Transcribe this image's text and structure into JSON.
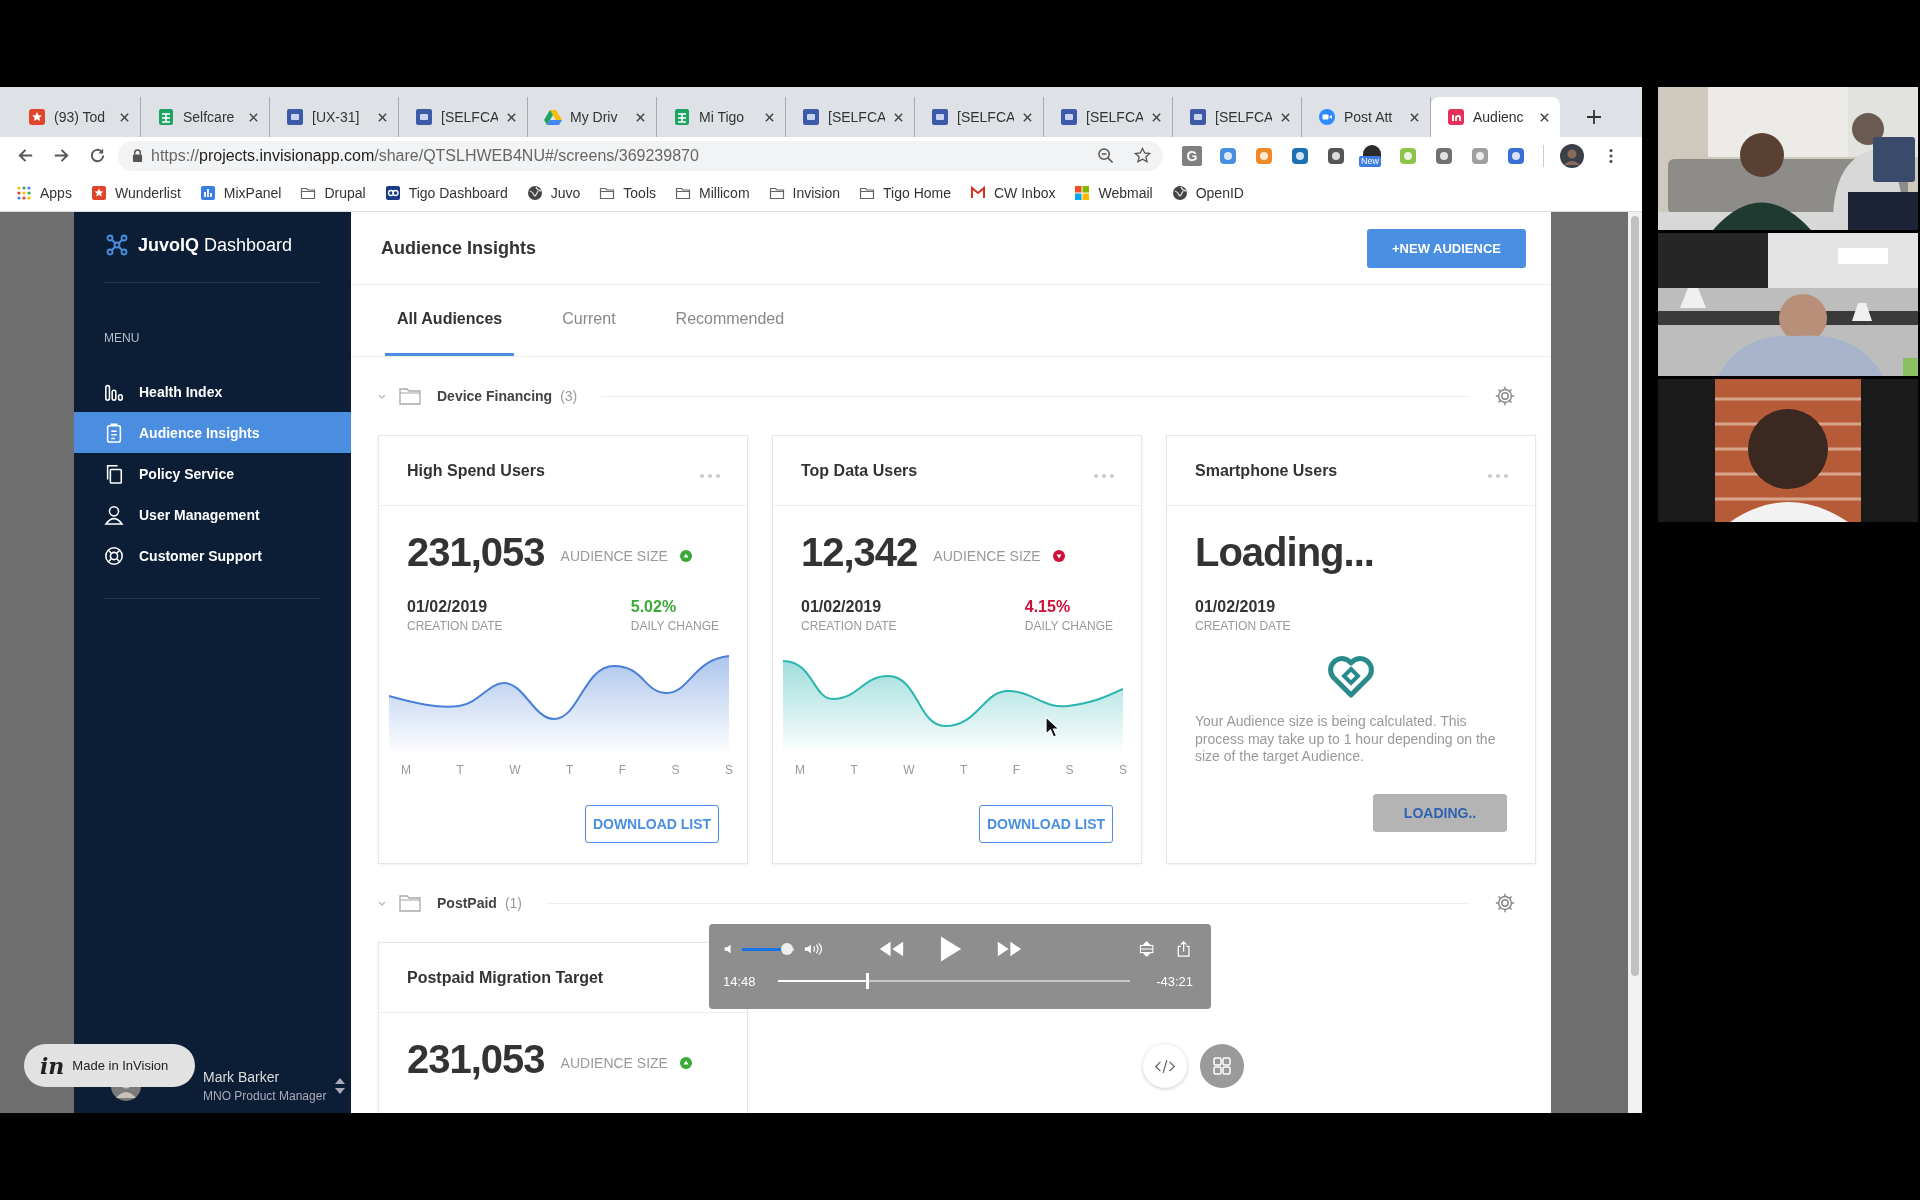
{
  "browser": {
    "tabs": [
      {
        "title": "(93) Tod",
        "kind": "star",
        "color": "#e0442c",
        "selected": false
      },
      {
        "title": "Selfcare",
        "kind": "sheet",
        "color": "#1fa463",
        "selected": false
      },
      {
        "title": "[UX-31]",
        "kind": "doc",
        "color": "#3d5aa8",
        "selected": false
      },
      {
        "title": "[SELFCA",
        "kind": "doc",
        "color": "#3d5aa8",
        "selected": false
      },
      {
        "title": "My Driv",
        "kind": "drive",
        "color": "#1fa463",
        "selected": false
      },
      {
        "title": "Mi Tigo",
        "kind": "sheet",
        "color": "#1fa463",
        "selected": false
      },
      {
        "title": "[SELFCA",
        "kind": "doc",
        "color": "#3d5aa8",
        "selected": false
      },
      {
        "title": "[SELFCA",
        "kind": "doc",
        "color": "#3d5aa8",
        "selected": false
      },
      {
        "title": "[SELFCA",
        "kind": "doc",
        "color": "#3d5aa8",
        "selected": false
      },
      {
        "title": "[SELFCA",
        "kind": "doc",
        "color": "#3d5aa8",
        "selected": false
      },
      {
        "title": "Post Att",
        "kind": "video",
        "color": "#2d8cff",
        "selected": false
      },
      {
        "title": "Audienc",
        "kind": "invision",
        "color": "#e6325a",
        "selected": true
      }
    ],
    "url": {
      "scheme": "https://",
      "host": "projects.invisionapp.com",
      "path": "/share/QTSLHWEB4NU#/screens/369239870"
    },
    "extensions": [
      {
        "kind": "letter",
        "label": "G",
        "color": "#808080"
      },
      {
        "kind": "plain",
        "color": "#4a8fe2"
      },
      {
        "kind": "plain",
        "color": "#f08a24"
      },
      {
        "kind": "plain",
        "color": "#1a6fb5"
      },
      {
        "kind": "plain",
        "color": "#555555"
      },
      {
        "kind": "badge",
        "badge": "New",
        "color": "#2a2a2a"
      },
      {
        "kind": "plain",
        "color": "#8bc34a"
      },
      {
        "kind": "plain",
        "color": "#707070"
      },
      {
        "kind": "plain",
        "color": "#a0a0a0"
      },
      {
        "kind": "plain",
        "color": "#3b6fd8"
      }
    ],
    "bookmarks": [
      {
        "label": "Apps",
        "kind": "apps"
      },
      {
        "label": "Wunderlist",
        "kind": "star"
      },
      {
        "label": "MixPanel",
        "kind": "chart"
      },
      {
        "label": "Drupal",
        "kind": "folder"
      },
      {
        "label": "Tigo Dashboard",
        "kind": "logo"
      },
      {
        "label": "Juvo",
        "kind": "globe"
      },
      {
        "label": "Tools",
        "kind": "folder"
      },
      {
        "label": "Millicom",
        "kind": "folder"
      },
      {
        "label": "Invision",
        "kind": "folder"
      },
      {
        "label": "Tigo Home",
        "kind": "folder"
      },
      {
        "label": "CW Inbox",
        "kind": "mail"
      },
      {
        "label": "Webmail",
        "kind": "windows"
      },
      {
        "label": "OpenID",
        "kind": "globe"
      }
    ]
  },
  "app": {
    "brand": "**JuvoIQ** Dashboard",
    "menu_label": "MENU",
    "menu": [
      {
        "label": "Health Index",
        "kind": "bars",
        "selected": false
      },
      {
        "label": "Audience Insights",
        "kind": "clipboard",
        "selected": true
      },
      {
        "label": "Policy Service",
        "kind": "copy",
        "selected": false
      },
      {
        "label": "User Management",
        "kind": "user",
        "selected": false
      },
      {
        "label": "Customer Support",
        "kind": "lifebuoy",
        "selected": false
      }
    ],
    "user": {
      "name": "Mark Barker",
      "role": "MNO Product Manager"
    },
    "page_title": "Audience Insights",
    "new_button": "+NEW AUDIENCE",
    "tabs": [
      {
        "label": "All Audiences",
        "selected": true
      },
      {
        "label": "Current",
        "selected": false
      },
      {
        "label": "Recommended",
        "selected": false
      }
    ],
    "groups": [
      {
        "name": "Device Financing",
        "count": "(3)",
        "cards": [
          {
            "kind": "stats",
            "title": "High Spend Users",
            "menu": true,
            "value": "231,053",
            "size_label": "AUDIENCE SIZE",
            "trend": {
              "kind": "up",
              "color": "#3aa935"
            },
            "date": "01/02/2019",
            "date_label": "CREATION DATE",
            "change": "5.02%",
            "change_label": "DAILY CHANGE",
            "color": "#4a7fd8",
            "days": [
              "M",
              "T",
              "W",
              "T",
              "F",
              "S",
              "S"
            ],
            "button": "DOWNLOAD LIST"
          },
          {
            "kind": "stats",
            "title": "Top Data Users",
            "menu": true,
            "value": "12,342",
            "size_label": "AUDIENCE SIZE",
            "trend": {
              "kind": "down",
              "color": "#d0103a"
            },
            "date": "01/02/2019",
            "date_label": "CREATION DATE",
            "change": "4.15%",
            "change_label": "DAILY CHANGE",
            "color": "#2bb5b0",
            "days": [
              "M",
              "T",
              "W",
              "T",
              "F",
              "S",
              "S"
            ],
            "button": "DOWNLOAD LIST"
          },
          {
            "kind": "loading",
            "title": "Smartphone Users",
            "menu": true,
            "value": "Loading...",
            "date": "01/02/2019",
            "date_label": "CREATION DATE",
            "message": "Your Audience size is being calculated. This process may take up to 1 hour depending on the size of the target Audience.",
            "button": "LOADING..",
            "disabled": true
          }
        ]
      },
      {
        "name": "PostPaid",
        "count": "(1)",
        "cards": [
          {
            "kind": "stats",
            "title": "Postpaid Migration Target",
            "menu": false,
            "value": "231,053",
            "size_label": "AUDIENCE SIZE",
            "trend": {
              "kind": "up",
              "color": "#3aa935"
            }
          }
        ]
      }
    ]
  },
  "player": {
    "volume": {
      "level": 0.85
    },
    "progress": {
      "level": 0.25
    },
    "elapsed": "14:48",
    "remaining": "-43:21"
  },
  "invision_badge": {
    "logo": "in",
    "label": "Made in InVision"
  }
}
